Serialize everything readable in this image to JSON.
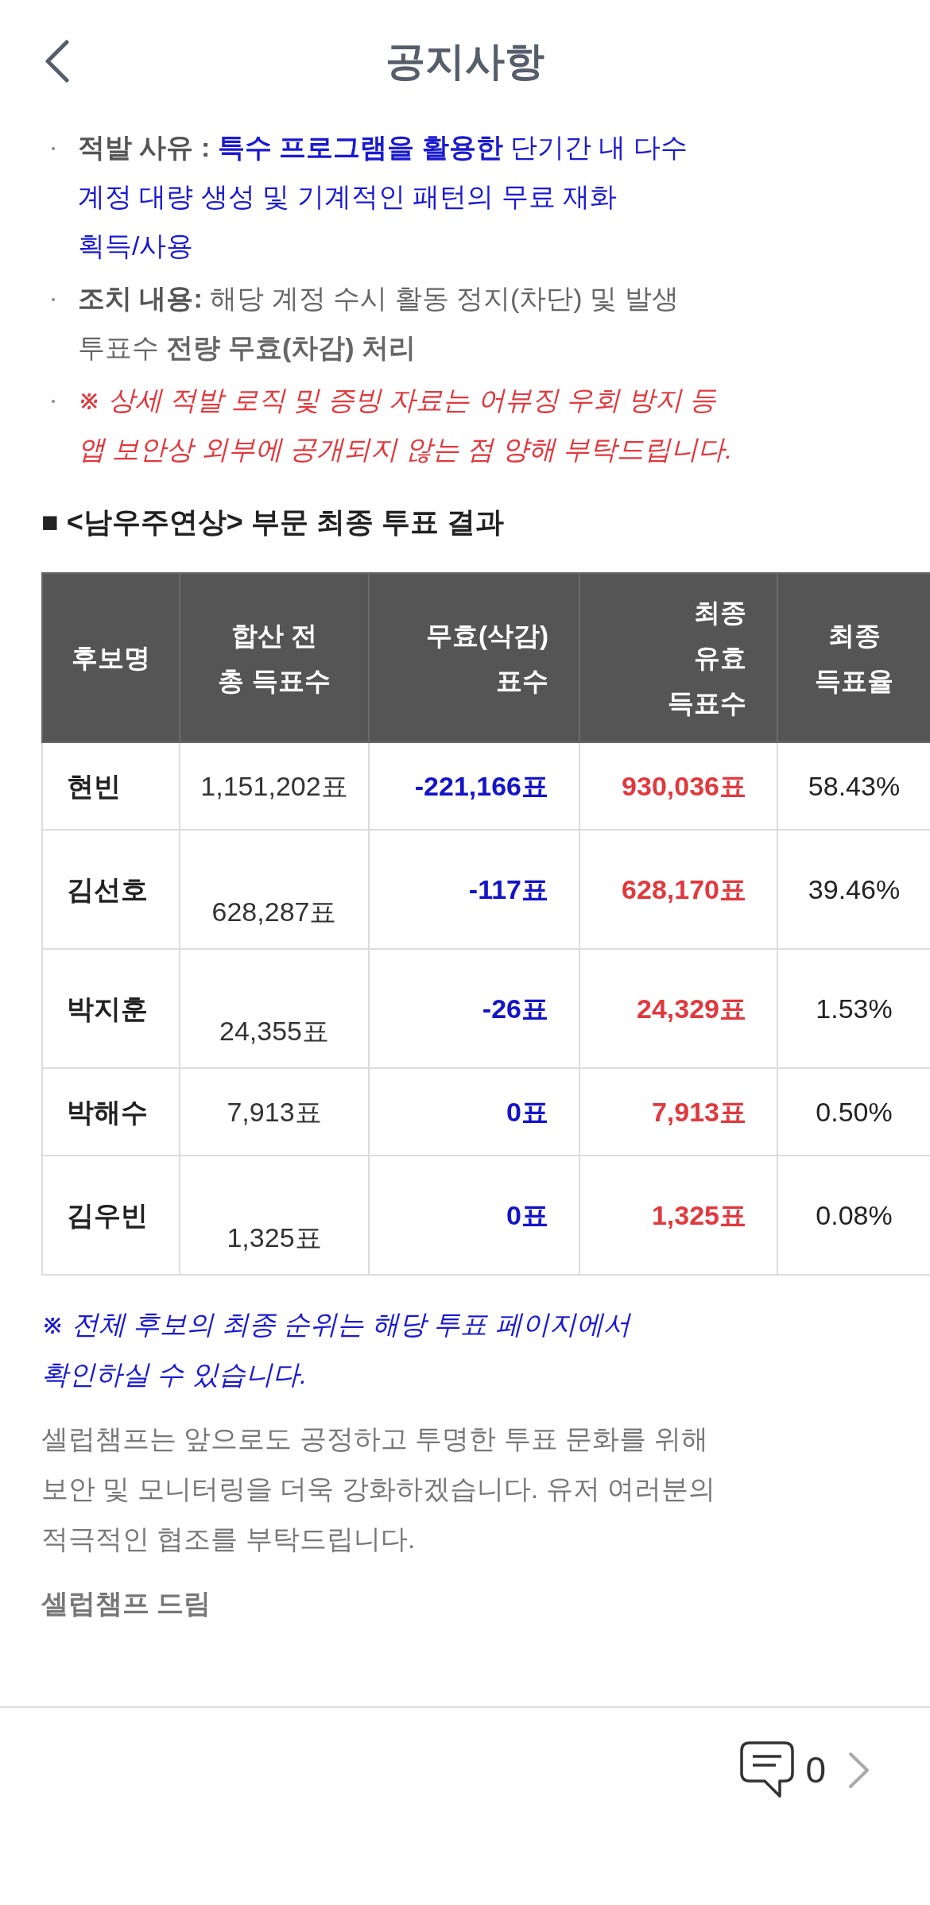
{
  "header": {
    "title": "공지사항"
  },
  "notice_items": [
    {
      "kind": "highlight",
      "label": "적발 사유 :",
      "text": "**특수 프로그램을 활용한** 단기간 내 다수 계정 대량 생성 및 기계적인 패턴의 무료 재화 획득/사용"
    },
    {
      "kind": "normal",
      "label": "조치 내용:",
      "text": "해당 계정 수시 활동 정지(차단) 및 발생 투표수 **전량 무효(차감) 처리**"
    },
    {
      "kind": "warning",
      "text": "※ 상세 적발 로직 및 증빙 자료는 어뷰징 우회 방지 등 앱 보안상 외부에 공개되지 않는 점 양해 부탁드립니다."
    }
  ],
  "section_title": "■ <남우주연상> 부문 최종 투표 결과",
  "table": {
    "columns": [
      {
        "lines": [
          "후보명"
        ]
      },
      {
        "lines": [
          "합산 전",
          "총 득표수"
        ]
      },
      {
        "lines": [
          "무효(삭감)",
          "표수"
        ]
      },
      {
        "lines": [
          "최종",
          "유효",
          "득표수"
        ]
      },
      {
        "lines": [
          "최종",
          "득표율"
        ]
      }
    ],
    "rows": [
      {
        "candidate": "현빈",
        "total": "1,151,202표",
        "total_on_second_line": false,
        "invalid": "-221,166표",
        "valid": "930,036표",
        "rate": "58.43%"
      },
      {
        "candidate": "김선호",
        "total": "628,287표",
        "total_on_second_line": true,
        "invalid": "-117표",
        "valid": "628,170표",
        "rate": "39.46%"
      },
      {
        "candidate": "박지훈",
        "total": "24,355표",
        "total_on_second_line": true,
        "invalid": "-26표",
        "valid": "24,329표",
        "rate": "1.53%"
      },
      {
        "candidate": "박해수",
        "total": "7,913표",
        "total_on_second_line": false,
        "invalid": "0표",
        "valid": "7,913표",
        "rate": "0.50%"
      },
      {
        "candidate": "김우빈",
        "total": "1,325표",
        "total_on_second_line": true,
        "invalid": "0표",
        "valid": "1,325표",
        "rate": "0.08%"
      }
    ]
  },
  "note": "※ 전체 후보의 최종 순위는 해당 투표 페이지에서 확인하실 수 있습니다.",
  "body": "셀럽챔프는 앞으로도 공정하고 투명한 투표 문화를 위해 보안 및 모니터링을 더욱 강화하겠습니다. 유저 여러분의 적극적인 협조를 부탁드립니다.",
  "signature": "셀럽챔프 드림",
  "footer": {
    "comment_count": "0"
  }
}
